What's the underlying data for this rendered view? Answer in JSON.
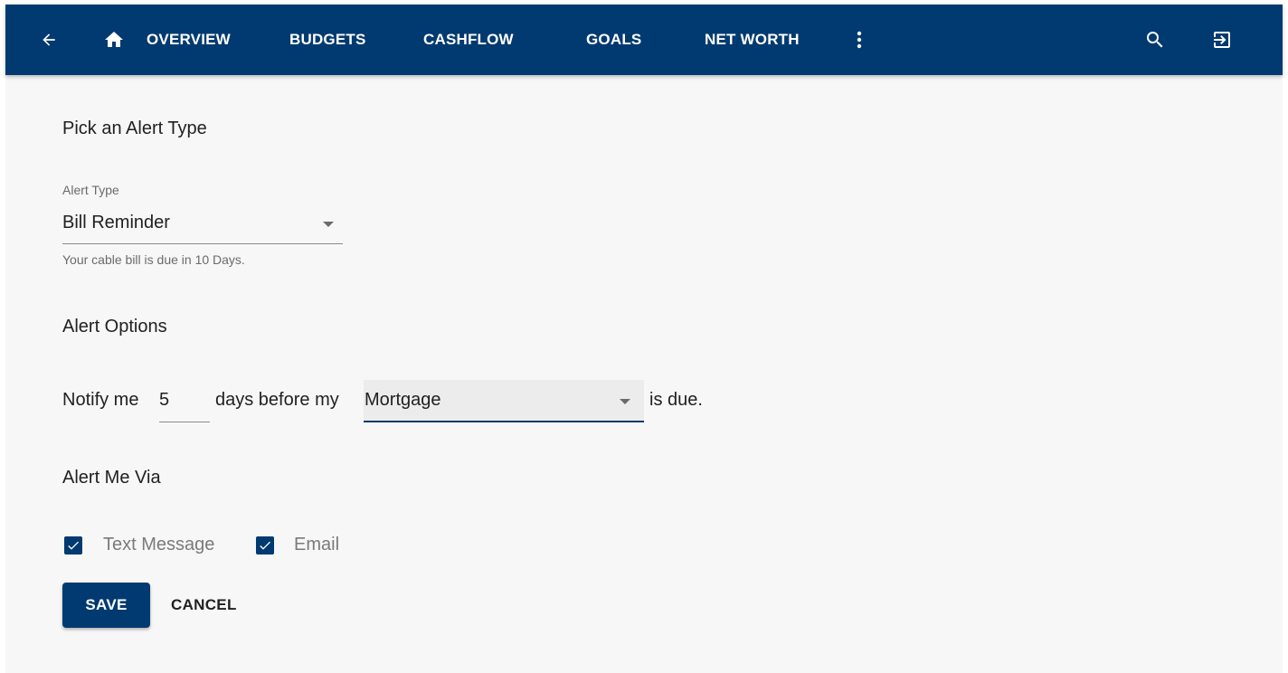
{
  "colors": {
    "primary": "#003a70",
    "background": "#f7f7f7",
    "text": "#212121",
    "muted": "#6b6b6b"
  },
  "header": {
    "back_icon": "arrow-left-icon",
    "home_icon": "home-icon",
    "nav": [
      "OVERVIEW",
      "BUDGETS",
      "CASHFLOW",
      "GOALS",
      "NET WORTH"
    ],
    "more_icon": "more-vertical-icon",
    "search_icon": "search-icon",
    "logout_icon": "logout-icon"
  },
  "alert_type_section": {
    "title": "Pick an Alert Type",
    "field_label": "Alert Type",
    "selected": "Bill Reminder",
    "helper": "Your cable bill is due in 10 Days."
  },
  "alert_options": {
    "title": "Alert Options",
    "prefix": "Notify me",
    "days_value": "5",
    "middle": "days before my",
    "bill_selected": "Mortgage",
    "suffix": "is due."
  },
  "alert_via": {
    "title": "Alert Me Via",
    "options": [
      {
        "label": "Text Message",
        "checked": true
      },
      {
        "label": "Email",
        "checked": true
      }
    ]
  },
  "actions": {
    "save": "SAVE",
    "cancel": "CANCEL"
  }
}
